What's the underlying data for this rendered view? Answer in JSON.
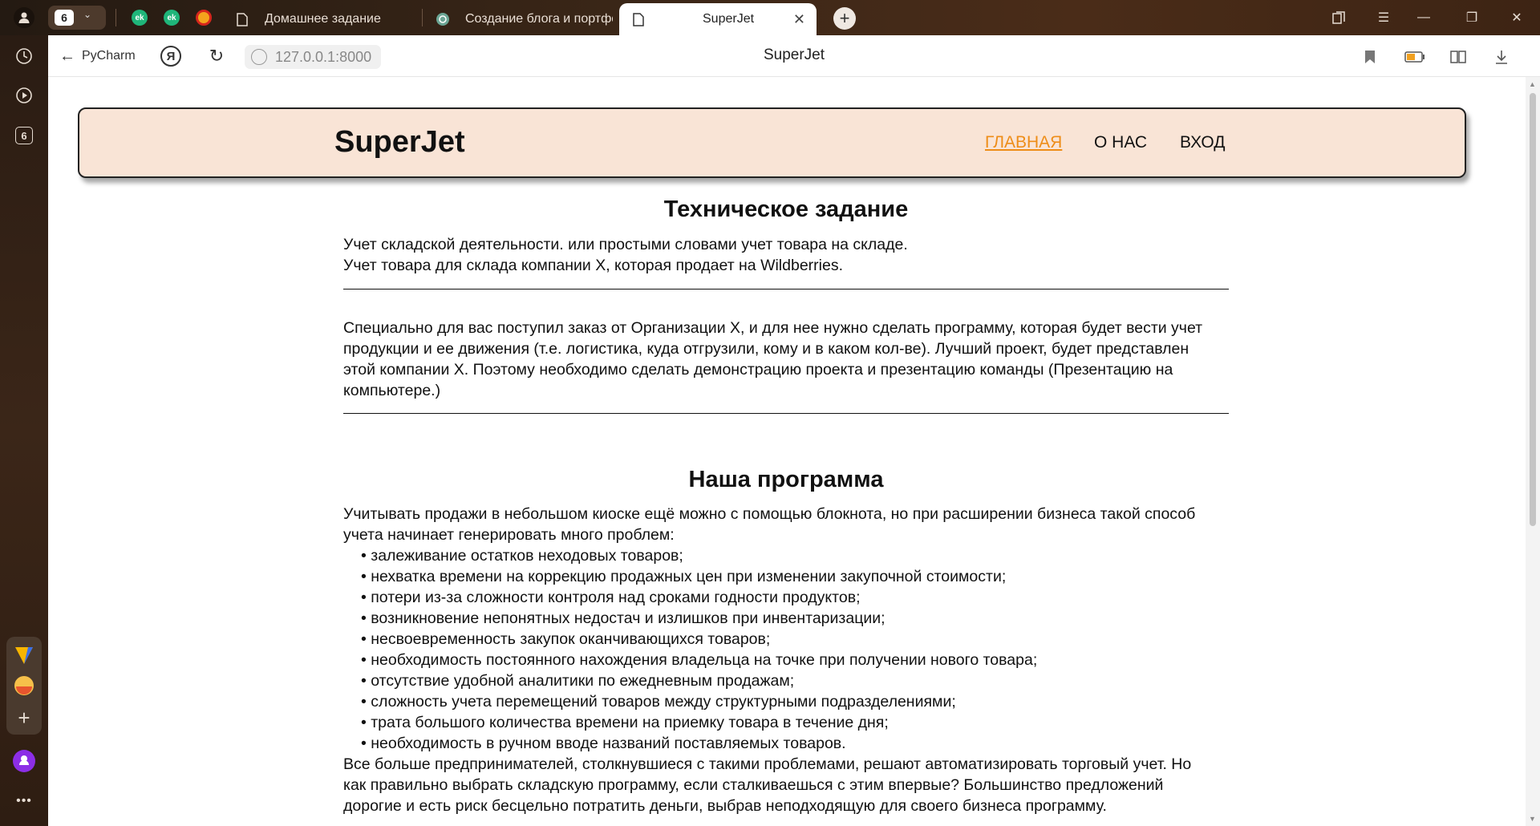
{
  "browser": {
    "group_count": "6",
    "tabs": [
      {
        "label": "Домашнее задание",
        "active": false
      },
      {
        "label": "Создание блога и портфо",
        "active": false
      },
      {
        "label": "SuperJet",
        "active": true
      }
    ],
    "back_label": "PyCharm",
    "yandex_label": "Я",
    "url": "127.0.0.1:8000",
    "page_title": "SuperJet",
    "sidebar_badge": "6",
    "sidebar_more": "•••"
  },
  "site": {
    "logo": "SuperJet",
    "nav": [
      "ГЛАВНАЯ",
      "О НАС",
      "ВХОД"
    ],
    "section1": {
      "title": "Техническое задание",
      "lines": [
        "Учет складской деятельности. или простыми словами учет товара на складе.",
        "Учет товара для склада компании X, которая продает на Wildberries."
      ],
      "paragraph": [
        "Специально для вас поступил заказ от Организации X, и для нее нужно сделать программу, которая будет вести учет",
        "продукции и ее движения (т.е. логистика, куда отгрузили, кому и в каком кол-ве). Лучший проект, будет представлен",
        "этой компании X. Поэтому необходимо сделать демонстрацию проекта и презентацию команды (Презентацию на",
        "компьютере.)"
      ]
    },
    "section2": {
      "title": "Наша программа",
      "intro": [
        "Учитывать продажи в небольшом киоске ещё можно с помощью блокнота, но при расширении бизнеса такой способ",
        "учета начинает генерировать много проблем:"
      ],
      "items": [
        "залеживание остатков неходовых товаров;",
        "нехватка времени на коррекцию продажных цен при изменении закупочной стоимости;",
        "потери из-за сложности контроля над сроками годности продуктов;",
        "возникновение непонятных недостач и излишков при инвентаризации;",
        "несвоевременность закупок оканчивающихся товаров;",
        "необходимость постоянного нахождения владельца на точке при получении нового товара;",
        "отсутствие удобной аналитики по ежедневным продажам;",
        "сложность учета перемещений товаров между структурными подразделениями;",
        "трата большого количества времени на приемку товара в течение дня;",
        "необходимость в ручном вводе названий поставляемых товаров."
      ],
      "outro": [
        "Все больше предпринимателей, столкнувшиеся с такими проблемами, решают автоматизировать торговый учет. Но",
        "как правильно выбрать складскую программу, если сталкиваешься с этим впервые? Большинство предложений",
        "дорогие и есть риск бесцельно потратить деньги, выбрав неподходящую для своего бизнеса программу."
      ]
    }
  },
  "colors": {
    "accent": "#ee8d18",
    "header_bg": "#f9e4d6"
  }
}
